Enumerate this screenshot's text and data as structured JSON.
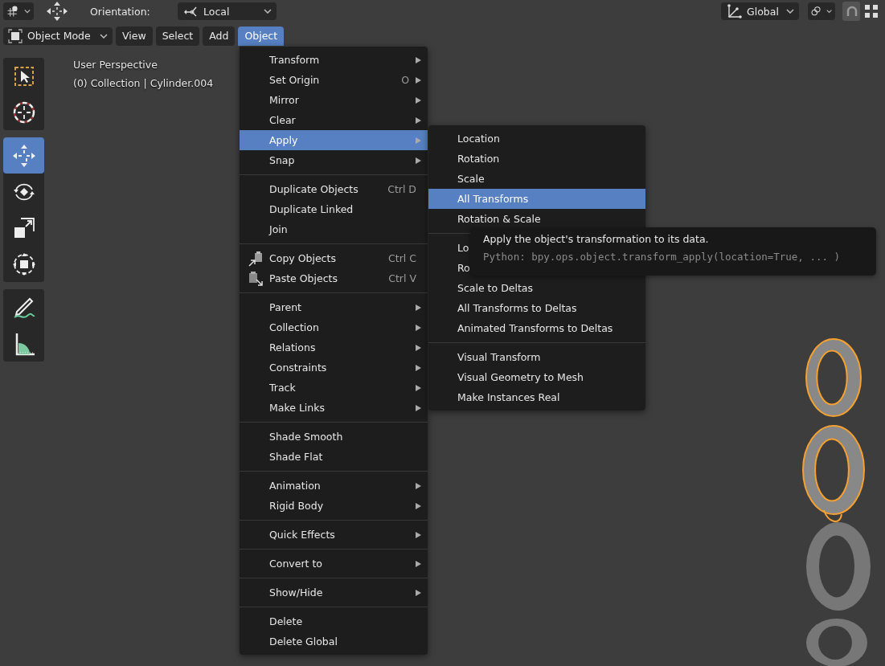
{
  "header": {
    "orientation_label": "Orientation:",
    "orientation": "Local",
    "transform_orientation": "Global",
    "snap": {
      "on": true
    }
  },
  "mode_menu": {
    "mode": "Object Mode"
  },
  "menus": [
    {
      "label": "View",
      "selected": false
    },
    {
      "label": "Select",
      "selected": false
    },
    {
      "label": "Add",
      "selected": false
    },
    {
      "label": "Object",
      "selected": true
    }
  ],
  "toolbar": {
    "groups": [
      [
        {
          "selected": false
        },
        {
          "selected": false
        }
      ],
      [
        {
          "selected": true
        },
        {
          "selected": false
        },
        {
          "selected": false
        },
        {
          "selected": false
        }
      ],
      [
        {
          "selected": false
        },
        {
          "selected": false
        }
      ]
    ]
  },
  "viewport": {
    "view_name": "User Perspective",
    "object_info": "(0) Collection | Cylinder.004"
  },
  "object_menu": {
    "sections": [
      [
        {
          "label": "Transform",
          "submenu": true,
          "selected": false
        },
        {
          "label": "Set Origin",
          "shortcut": "O",
          "submenu": true,
          "selected": false
        },
        {
          "label": "Mirror",
          "submenu": true,
          "selected": false
        },
        {
          "label": "Clear",
          "submenu": true,
          "selected": false
        },
        {
          "label": "Apply",
          "submenu": true,
          "selected": true
        },
        {
          "label": "Snap",
          "submenu": true,
          "selected": false
        }
      ],
      [
        {
          "label": "Duplicate Objects",
          "shortcut": "Ctrl D",
          "submenu": false,
          "selected": false
        },
        {
          "label": "Duplicate Linked",
          "submenu": false,
          "selected": false
        },
        {
          "label": "Join",
          "submenu": false,
          "selected": false
        }
      ],
      [
        {
          "label": "Copy Objects",
          "shortcut": "Ctrl C",
          "icon": true,
          "submenu": false,
          "selected": false
        },
        {
          "label": "Paste Objects",
          "shortcut": "Ctrl V",
          "icon": true,
          "submenu": false,
          "selected": false
        }
      ],
      [
        {
          "label": "Parent",
          "submenu": true,
          "selected": false
        },
        {
          "label": "Collection",
          "submenu": true,
          "selected": false
        },
        {
          "label": "Relations",
          "submenu": true,
          "selected": false
        },
        {
          "label": "Constraints",
          "submenu": true,
          "selected": false
        },
        {
          "label": "Track",
          "submenu": true,
          "selected": false
        },
        {
          "label": "Make Links",
          "submenu": true,
          "selected": false
        }
      ],
      [
        {
          "label": "Shade Smooth",
          "submenu": false,
          "selected": false
        },
        {
          "label": "Shade Flat",
          "submenu": false,
          "selected": false
        }
      ],
      [
        {
          "label": "Animation",
          "submenu": true,
          "selected": false
        },
        {
          "label": "Rigid Body",
          "submenu": true,
          "selected": false
        }
      ],
      [
        {
          "label": "Quick Effects",
          "submenu": true,
          "selected": false
        }
      ],
      [
        {
          "label": "Convert to",
          "submenu": true,
          "selected": false
        }
      ],
      [
        {
          "label": "Show/Hide",
          "submenu": true,
          "selected": false
        }
      ],
      [
        {
          "label": "Delete",
          "submenu": false,
          "selected": false
        },
        {
          "label": "Delete Global",
          "submenu": false,
          "selected": false
        }
      ]
    ]
  },
  "apply_menu": {
    "sections": [
      [
        {
          "label": "Location",
          "selected": false
        },
        {
          "label": "Rotation",
          "selected": false
        },
        {
          "label": "Scale",
          "selected": false
        },
        {
          "label": "All Transforms",
          "selected": true
        },
        {
          "label": "Rotation & Scale",
          "selected": false
        }
      ],
      [
        {
          "label": "Lo",
          "selected": false
        },
        {
          "label": "Ro",
          "selected": false
        },
        {
          "label": "Scale to Deltas",
          "selected": false
        },
        {
          "label": "All Transforms to Deltas",
          "selected": false
        },
        {
          "label": "Animated Transforms to Deltas",
          "selected": false
        }
      ],
      [
        {
          "label": "Visual Transform",
          "selected": false
        },
        {
          "label": "Visual Geometry to Mesh",
          "selected": false
        },
        {
          "label": "Make Instances Real",
          "selected": false
        }
      ]
    ]
  },
  "tooltip": {
    "description": "Apply the object's transformation to its data.",
    "python": "Python: bpy.ops.object.transform_apply(location=True, ... )"
  }
}
